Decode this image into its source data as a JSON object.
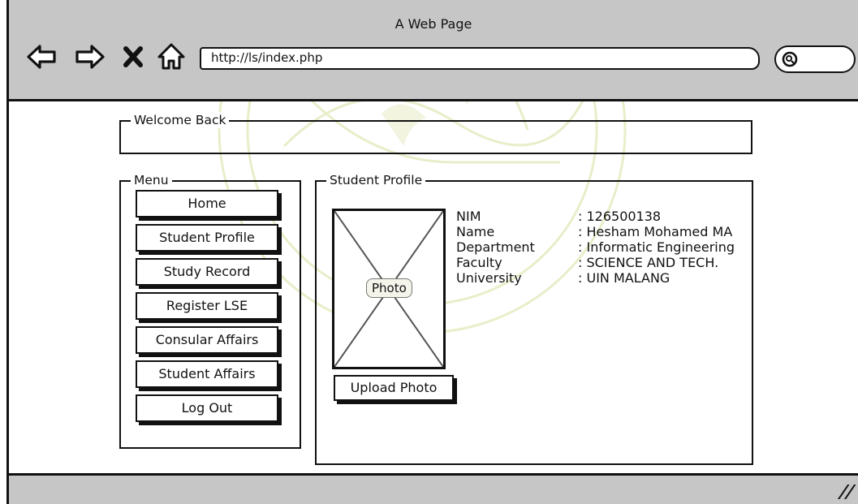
{
  "window": {
    "title": "A Web Page"
  },
  "address_bar": {
    "url": "http://ls/index.php"
  },
  "welcome": {
    "legend": "Welcome Back"
  },
  "menu": {
    "legend": "Menu",
    "items": [
      {
        "label": "Home"
      },
      {
        "label": "Student Profile"
      },
      {
        "label": "Study Record"
      },
      {
        "label": "Register LSE"
      },
      {
        "label": "Consular Affairs"
      },
      {
        "label": "Student Affairs"
      },
      {
        "label": "Log Out"
      }
    ]
  },
  "profile": {
    "legend": "Student Profile",
    "photo_label": "Photo",
    "upload_label": "Upload Photo",
    "fields": [
      {
        "label": "NIM",
        "value": ": 126500138"
      },
      {
        "label": "Name",
        "value": ": Hesham Mohamed MA"
      },
      {
        "label": "Department",
        "value": ": Informatic Engineering"
      },
      {
        "label": "Faculty",
        "value": ": SCIENCE AND TECH."
      },
      {
        "label": "University",
        "value": ": UIN MALANG"
      }
    ]
  },
  "icons": {
    "back": "back-arrow-icon",
    "forward": "forward-arrow-icon",
    "stop": "stop-x-icon",
    "home": "home-icon",
    "search": "search-icon",
    "resize": "resize-grip-icon"
  }
}
